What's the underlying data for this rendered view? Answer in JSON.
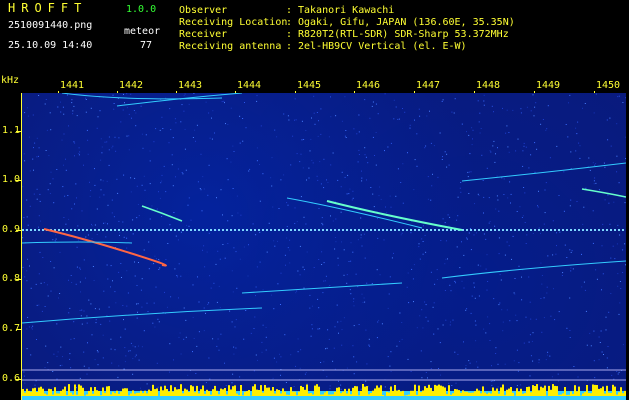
{
  "header": {
    "app_name": "HROFFT",
    "version": "1.0.0",
    "filename": "2510091440.png",
    "datetime": "25.10.09 14:40",
    "meteor_label": "meteor",
    "meteor_count": "77",
    "rows": [
      {
        "label": "Observer",
        "value": "Takanori Kawachi"
      },
      {
        "label": "Receiving Location",
        "value": "Ogaki, Gifu, JAPAN (136.60E, 35.35N)"
      },
      {
        "label": "Receiver",
        "value": "R820T2(RTL-SDR) SDR-Sharp 53.372MHz"
      },
      {
        "label": "Receiving antenna",
        "value": "2el-HB9CV Vertical (el. E-W)"
      }
    ],
    "separator": ":"
  },
  "axes": {
    "y_unit": "kHz",
    "x_ticks": [
      "1441",
      "1442",
      "1443",
      "1444",
      "1445",
      "1446",
      "1447",
      "1448",
      "1449",
      "1450"
    ],
    "y_ticks": [
      "1.1",
      "1.0",
      "0.9",
      "0.8",
      "0.7",
      "0.6"
    ]
  },
  "colors": {
    "background": "#000000",
    "label_yellow": "#ffff33",
    "label_green": "#33ff33",
    "spectrogram_base": "#0a1a7a",
    "carrier_line": "#7fd8ff",
    "noise_floor": "#ffee00",
    "noise_base": "#33ccff"
  }
}
